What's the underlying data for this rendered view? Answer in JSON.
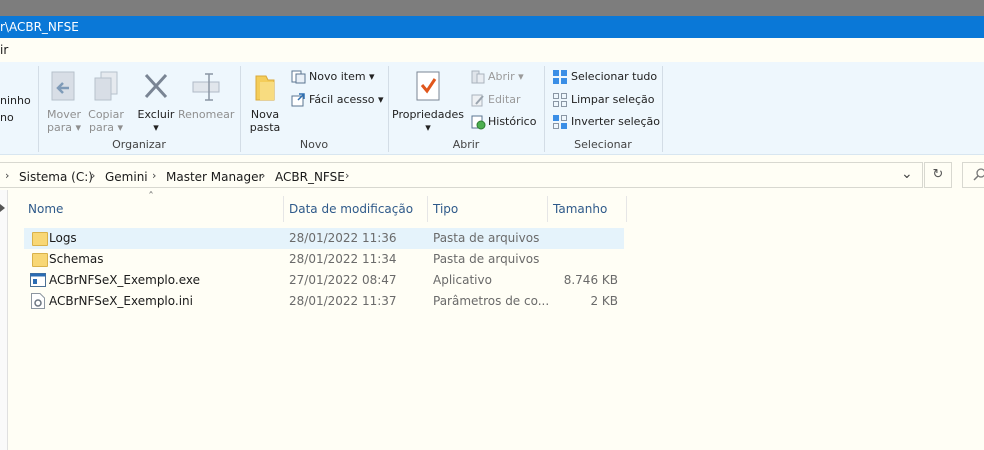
{
  "window": {
    "title": "r\\ACBR_NFSE"
  },
  "menu": {
    "visible_text": "ir"
  },
  "ribbon": {
    "partial_left": {
      "line1": "ninho",
      "line2": "no"
    },
    "organizar": {
      "label": "Organizar",
      "mover": {
        "line1": "Mover",
        "line2": "para ▾"
      },
      "copiar": {
        "line1": "Copiar",
        "line2": "para ▾"
      },
      "excluir": {
        "line1": "Excluir",
        "line2": "▾"
      },
      "renomear": {
        "line1": "Renomear"
      }
    },
    "novo": {
      "label": "Novo",
      "nova_pasta": {
        "line1": "Nova",
        "line2": "pasta"
      },
      "novo_item": "Novo item ▾",
      "facil_acesso": "Fácil acesso ▾"
    },
    "abrir": {
      "label": "Abrir",
      "propriedades": {
        "line1": "Propriedades",
        "line2": "▾"
      },
      "abrir": "Abrir ▾",
      "editar": "Editar",
      "historico": "Histórico"
    },
    "selecionar": {
      "label": "Selecionar",
      "selecionar_tudo": "Selecionar tudo",
      "limpar_selecao": "Limpar seleção",
      "inverter_selecao": "Inverter seleção"
    }
  },
  "address": {
    "crumbs": [
      "Sistema (C:)",
      "Gemini",
      "Master Manager",
      "ACBR_NFSE"
    ],
    "sep": "›",
    "dropdown": "⌄",
    "refresh": "↻"
  },
  "columns": {
    "name": "Nome",
    "modified": "Data de modificação",
    "type": "Tipo",
    "size": "Tamanho",
    "sort_indicator": "ˆ"
  },
  "files": [
    {
      "name": "Logs",
      "modified": "28/01/2022 11:36",
      "type": "Pasta de arquivos",
      "size": "",
      "icon": "folder-icon"
    },
    {
      "name": "Schemas",
      "modified": "28/01/2022 11:34",
      "type": "Pasta de arquivos",
      "size": "",
      "icon": "folder-icon"
    },
    {
      "name": "ACBrNFSeX_Exemplo.exe",
      "modified": "27/01/2022 08:47",
      "type": "Aplicativo",
      "size": "8.746 KB",
      "icon": "exe-icon"
    },
    {
      "name": "ACBrNFSeX_Exemplo.ini",
      "modified": "28/01/2022 11:37",
      "type": "Parâmetros de co...",
      "size": "2 KB",
      "icon": "ini-file-icon"
    }
  ],
  "colors": {
    "titlebar": "#0a78d7",
    "ribbon": "#eef7fd",
    "selection": "#e5f3fb",
    "background": "#fffef5"
  }
}
